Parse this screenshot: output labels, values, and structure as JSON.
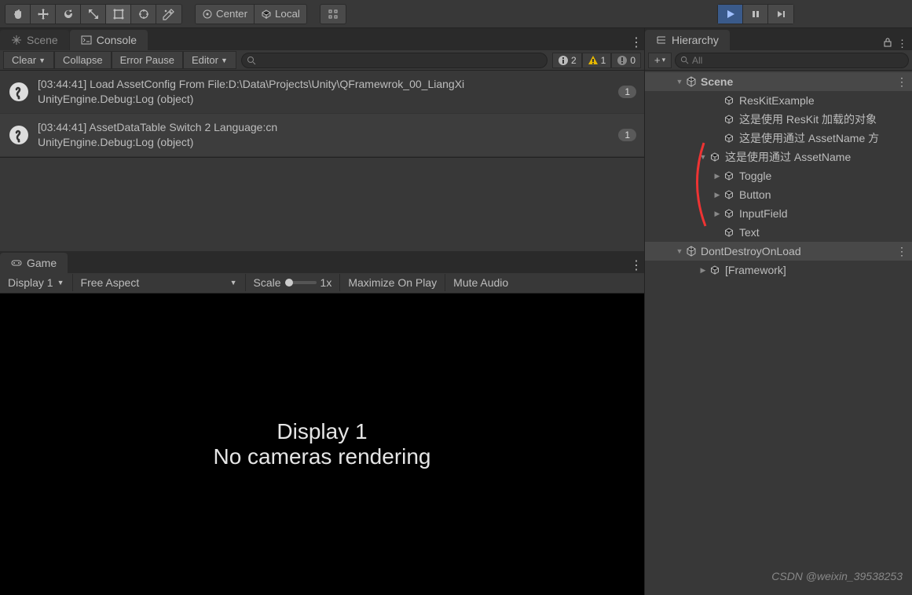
{
  "toolbar": {
    "center_label": "Center",
    "local_label": "Local"
  },
  "tabs": {
    "scene": "Scene",
    "console": "Console"
  },
  "console": {
    "clear": "Clear",
    "collapse": "Collapse",
    "error_pause": "Error Pause",
    "editor": "Editor",
    "info_count": "2",
    "warn_count": "1",
    "error_count": "0",
    "entries": [
      {
        "time": "[03:44:41]",
        "msg": "Load AssetConfig From File:D:\\Data\\Projects\\Unity\\QFramewrok_00_LiangXi",
        "sub": "UnityEngine.Debug:Log (object)",
        "count": "1"
      },
      {
        "time": "[03:44:41]",
        "msg": "AssetDataTable Switch 2 Language:cn",
        "sub": "UnityEngine.Debug:Log (object)",
        "count": "1"
      }
    ]
  },
  "game": {
    "tab": "Game",
    "display": "Display 1",
    "aspect": "Free Aspect",
    "scale_label": "Scale",
    "scale_value": "1x",
    "maximize": "Maximize On Play",
    "mute": "Mute Audio",
    "view_line1": "Display 1",
    "view_line2": "No cameras rendering"
  },
  "hierarchy": {
    "tab": "Hierarchy",
    "search_placeholder": "All",
    "root": "Scene",
    "items": [
      {
        "name": "ResKitExample",
        "indent": 2
      },
      {
        "name": "这是使用 ResKit 加载的对象",
        "indent": 2
      },
      {
        "name": "这是使用通过 AssetName 方",
        "indent": 2
      },
      {
        "name": "这是使用通过 AssetName",
        "indent": 1,
        "expandable": true,
        "expanded": true
      },
      {
        "name": "Toggle",
        "indent": 2,
        "expandable": true
      },
      {
        "name": "Button",
        "indent": 2,
        "expandable": true
      },
      {
        "name": "InputField",
        "indent": 2,
        "expandable": true
      },
      {
        "name": "Text",
        "indent": 2
      }
    ],
    "root2": "DontDestroyOnLoad",
    "items2": [
      {
        "name": "[Framework]",
        "indent": 1,
        "expandable": true
      }
    ]
  },
  "watermark": "CSDN @weixin_39538253"
}
